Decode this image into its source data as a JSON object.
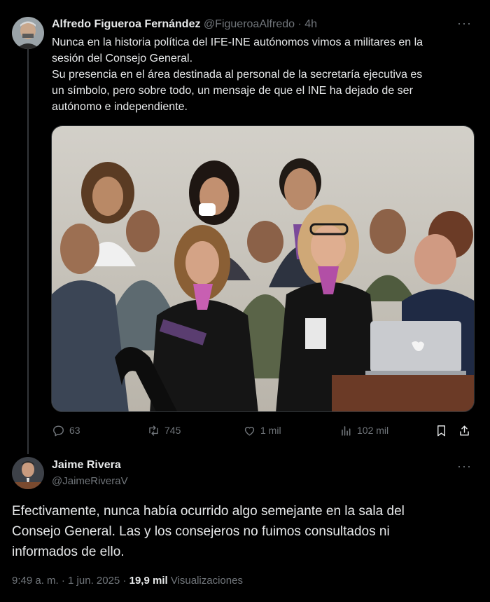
{
  "tweet1": {
    "author_name": "Alfredo Figueroa Fernández",
    "handle": "@FigueroaAlfredo",
    "separator": "·",
    "time": "4h",
    "more": "···",
    "text_lines": [
      "Nunca en la historia política del IFE-INE autónomos vimos a militares en la",
      "sesión del Consejo General.",
      "Su presencia en el área destinada al personal de la secretaría ejecutiva es",
      "un símbolo, pero sobre todo, un mensaje de que el INE ha dejado de ser",
      "autónomo e independiente."
    ],
    "actions": {
      "replies": "63",
      "reposts": "745",
      "likes": "1 mil",
      "views": "102 mil"
    },
    "icons": [
      "reply-icon",
      "repost-icon",
      "like-icon",
      "views-icon",
      "bookmark-icon",
      "share-icon"
    ]
  },
  "tweet2": {
    "author_name": "Jaime Rivera",
    "handle": "@JaimeRiveraV",
    "more": "···",
    "text_lines": [
      "Efectivamente, nunca había ocurrido algo semejante en la sala del",
      "Consejo General. Las y los consejeros no fuimos consultados ni",
      "informados de ello."
    ],
    "time": "9:49 a. m.",
    "date": "1 jun. 2025",
    "views_count": "19,9 mil",
    "views_label": "Visualizaciones",
    "dot": "·"
  },
  "colors": {
    "background": "#000000",
    "text": "#e7e9ea",
    "muted": "#71767b",
    "divider": "#2f3336"
  }
}
